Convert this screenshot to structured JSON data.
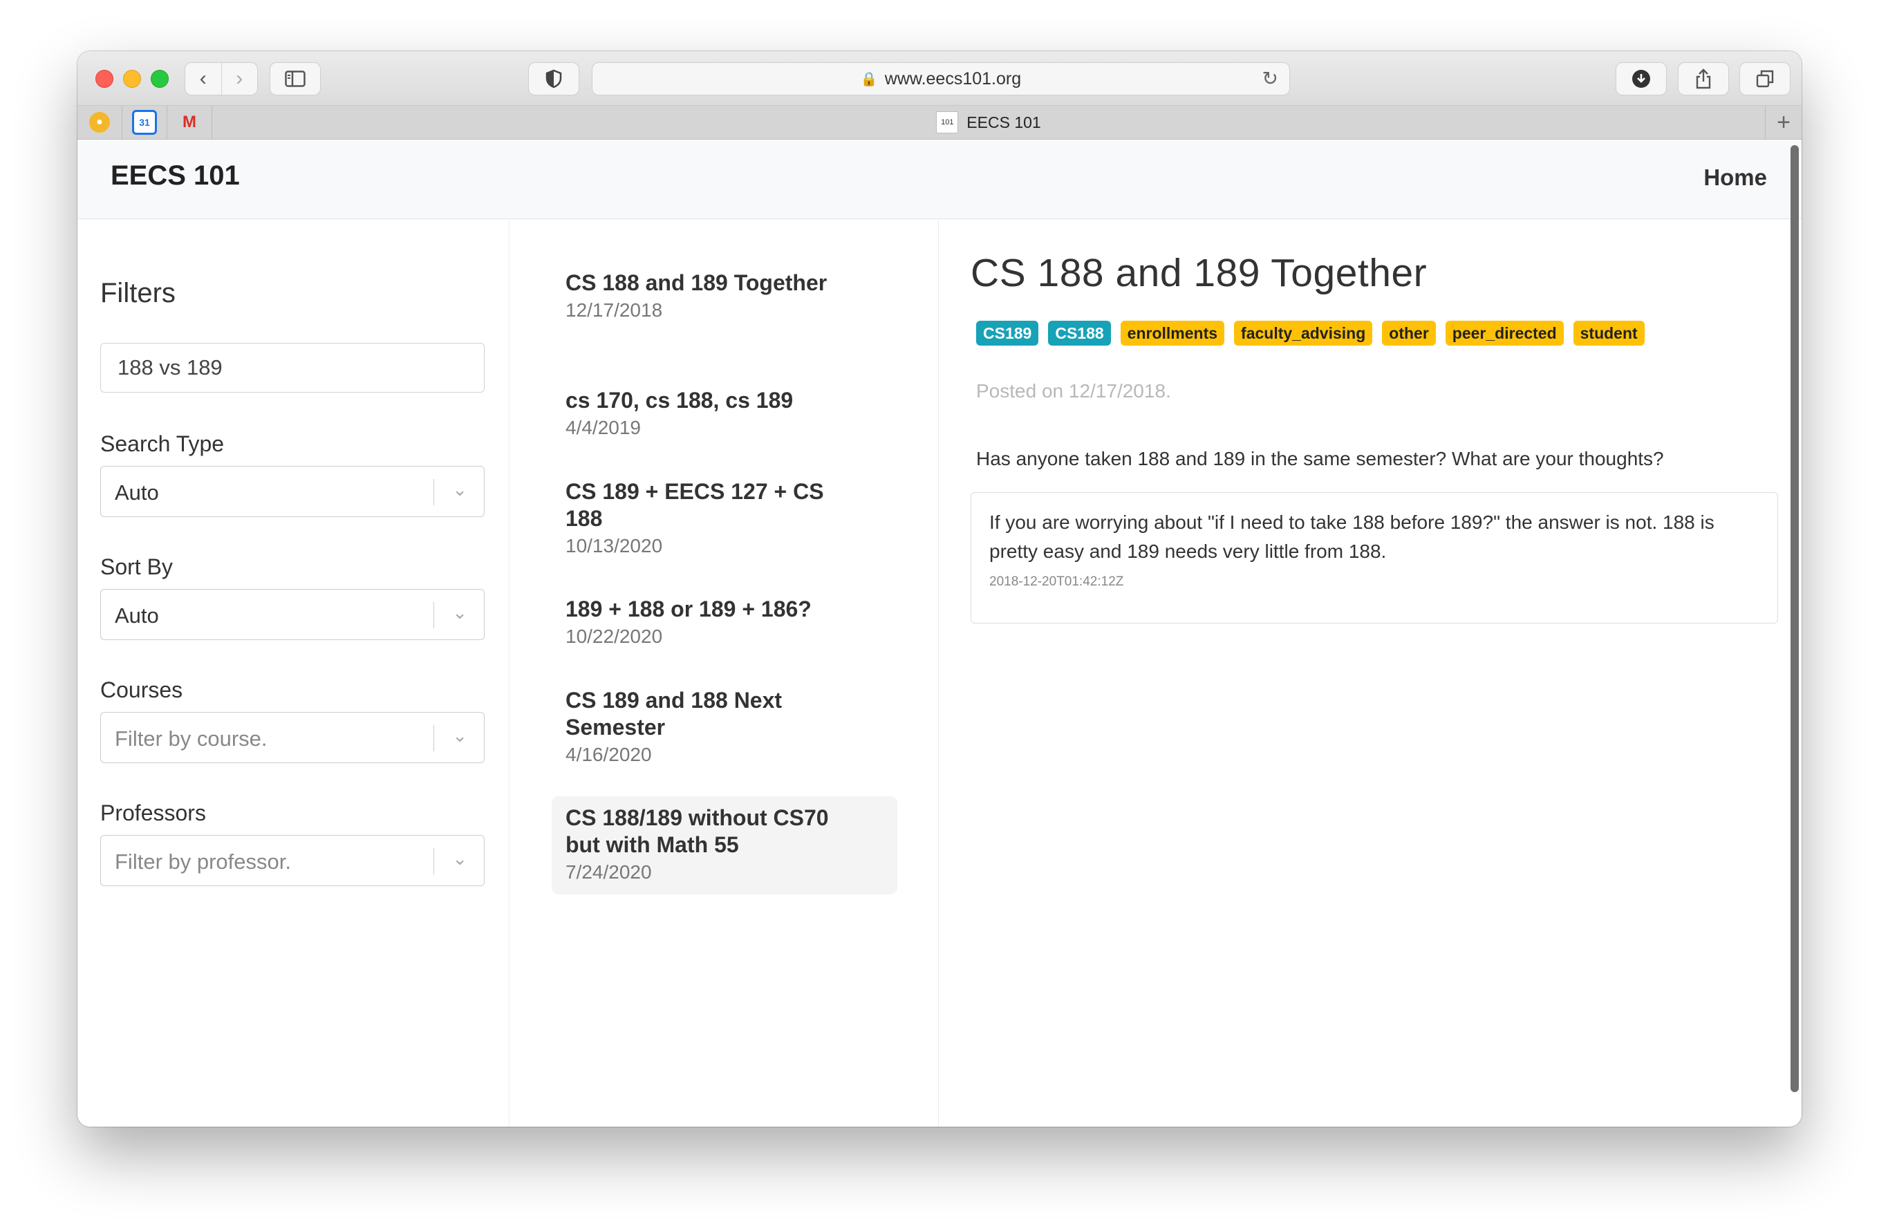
{
  "browser": {
    "url": "www.eecs101.org",
    "tab_title": "EECS 101",
    "tab_favicon_text": "101",
    "nav_back": "‹",
    "nav_forward": "›"
  },
  "navbar": {
    "brand": "EECS 101",
    "home": "Home"
  },
  "filters": {
    "heading": "Filters",
    "search_value": "188 vs 189",
    "search_type": {
      "label": "Search Type",
      "value": "Auto"
    },
    "sort_by": {
      "label": "Sort By",
      "value": "Auto"
    },
    "courses": {
      "label": "Courses",
      "placeholder": "Filter by course."
    },
    "professors": {
      "label": "Professors",
      "placeholder": "Filter by professor."
    }
  },
  "results": [
    {
      "title": "CS 188 and 189 Together",
      "date": "12/17/2018"
    },
    {
      "title": "cs 170, cs 188, cs 189",
      "date": "4/4/2019"
    },
    {
      "title": "CS 189 + EECS 127 + CS 188",
      "date": "10/13/2020"
    },
    {
      "title": "189 + 188 or 189 + 186?",
      "date": "10/22/2020"
    },
    {
      "title": "CS 189 and 188 Next Semester",
      "date": "4/16/2020"
    },
    {
      "title": "CS 188/189 without CS70 but with Math 55",
      "date": "7/24/2020"
    }
  ],
  "detail": {
    "title": "CS 188 and 189 Together",
    "tags": {
      "course_1": "CS189",
      "course_2": "CS188",
      "label_1": "enrollments",
      "label_2": "faculty_advising",
      "label_3": "other",
      "label_4": "peer_directed",
      "label_5": "student"
    },
    "posted": "Posted on 12/17/2018.",
    "question": "Has anyone taken 188 and 189 in the same semester? What are your thoughts?",
    "answer": {
      "body": "If you are worrying about \"if I need to take 188 before 189?\" the answer is not. 188 is pretty easy and 189 needs very little from 188.",
      "timestamp": "2018-12-20T01:42:12Z"
    }
  },
  "colors": {
    "course_tag": "#17a2b8",
    "label_tag": "#ffc107",
    "navbar_bg": "#f8f9fa"
  }
}
